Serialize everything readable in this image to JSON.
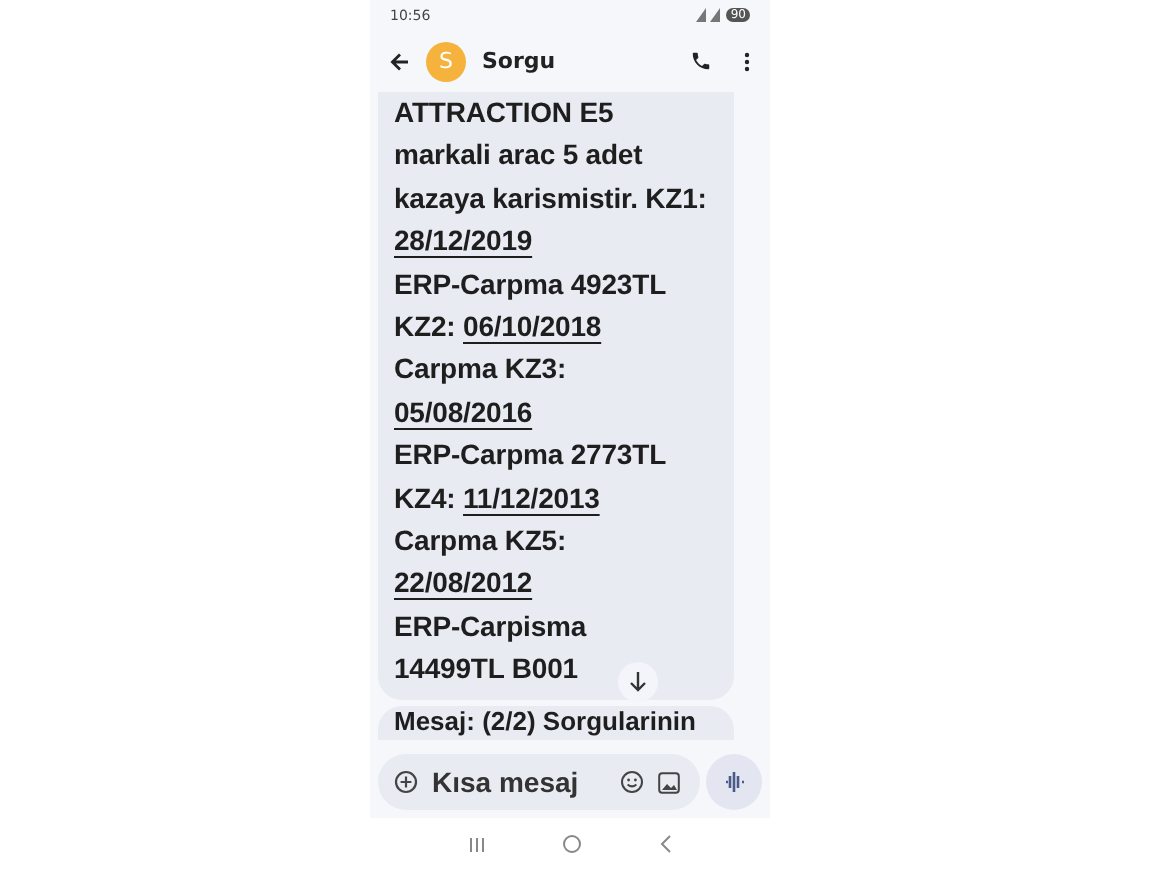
{
  "status_bar": {
    "time": "10:56",
    "battery": "90"
  },
  "header": {
    "contact_initial": "S",
    "contact_name": "Sorgu"
  },
  "message": {
    "lines": [
      [
        {
          "kind": "text",
          "text": "ATTRACTION E5"
        }
      ],
      [
        {
          "kind": "text",
          "text": "markali arac 5 adet"
        }
      ],
      [
        {
          "kind": "text",
          "text": "kazaya karismistir. KZ1:"
        }
      ],
      [
        {
          "kind": "date",
          "text": "28/12/2019"
        }
      ],
      [
        {
          "kind": "text",
          "text": "ERP-Carpma 4923TL"
        }
      ],
      [
        {
          "kind": "text",
          "text": "KZ2: "
        },
        {
          "kind": "date",
          "text": "06/10/2018"
        }
      ],
      [
        {
          "kind": "text",
          "text": "Carpma KZ3:"
        }
      ],
      [
        {
          "kind": "date",
          "text": "05/08/2016"
        }
      ],
      [
        {
          "kind": "text",
          "text": "ERP-Carpma 2773TL"
        }
      ],
      [
        {
          "kind": "text",
          "text": "KZ4: "
        },
        {
          "kind": "date",
          "text": "11/12/2013"
        }
      ],
      [
        {
          "kind": "text",
          "text": "Carpma KZ5:"
        }
      ],
      [
        {
          "kind": "date",
          "text": "22/08/2012"
        }
      ],
      [
        {
          "kind": "text",
          "text": "ERP-Carpisma"
        }
      ],
      [
        {
          "kind": "text",
          "text": "14499TL B001"
        }
      ]
    ]
  },
  "next_message": {
    "text": "Mesaj: (2/2) Sorgularinin"
  },
  "composer": {
    "placeholder": "Kısa mesaj"
  }
}
